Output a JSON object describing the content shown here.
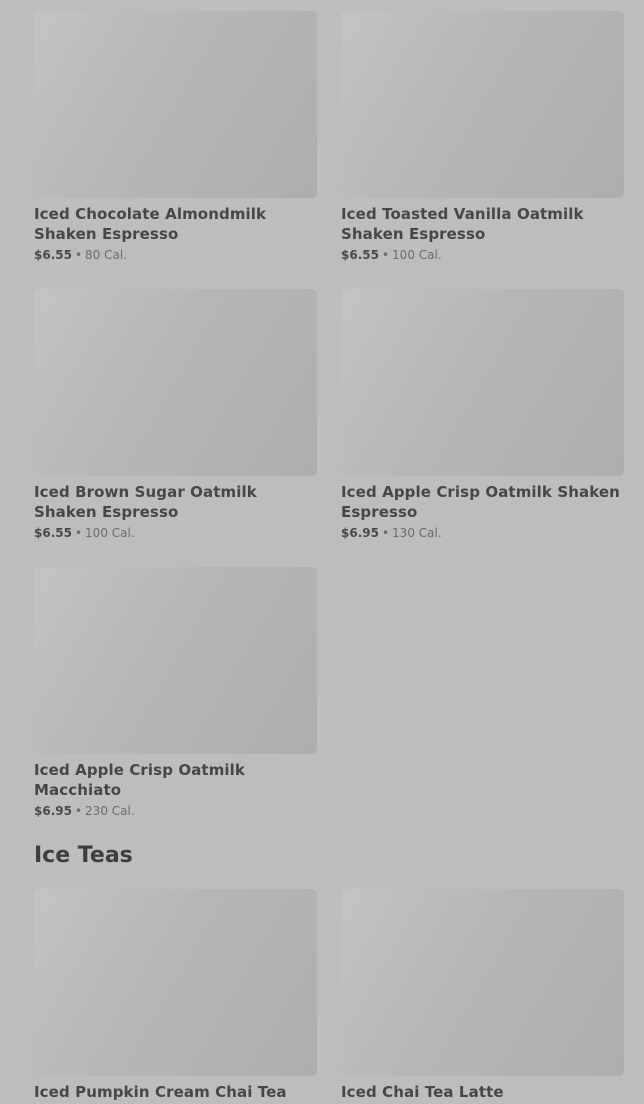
{
  "sections": [
    {
      "title": "",
      "items": [
        {
          "name": "Iced Chocolate Almondmilk Shaken Espresso",
          "price": "$6.55",
          "separator": "•",
          "calories": "80 Cal."
        },
        {
          "name": "Iced Toasted Vanilla Oatmilk Shaken Espresso",
          "price": "$6.55",
          "separator": "•",
          "calories": "100 Cal."
        },
        {
          "name": "Iced Brown Sugar Oatmilk Shaken Espresso",
          "price": "$6.55",
          "separator": "•",
          "calories": "100 Cal."
        },
        {
          "name": "Iced Apple Crisp Oatmilk Shaken Espresso",
          "price": "$6.95",
          "separator": "•",
          "calories": "130 Cal."
        },
        {
          "name": "Iced Apple Crisp Oatmilk Macchiato",
          "price": "$6.95",
          "separator": "•",
          "calories": "230 Cal."
        }
      ]
    },
    {
      "title": "Ice Teas",
      "items": [
        {
          "name": "Iced Pumpkin Cream Chai Tea Latte"
        },
        {
          "name": "Iced Chai Tea Latte"
        }
      ]
    }
  ]
}
